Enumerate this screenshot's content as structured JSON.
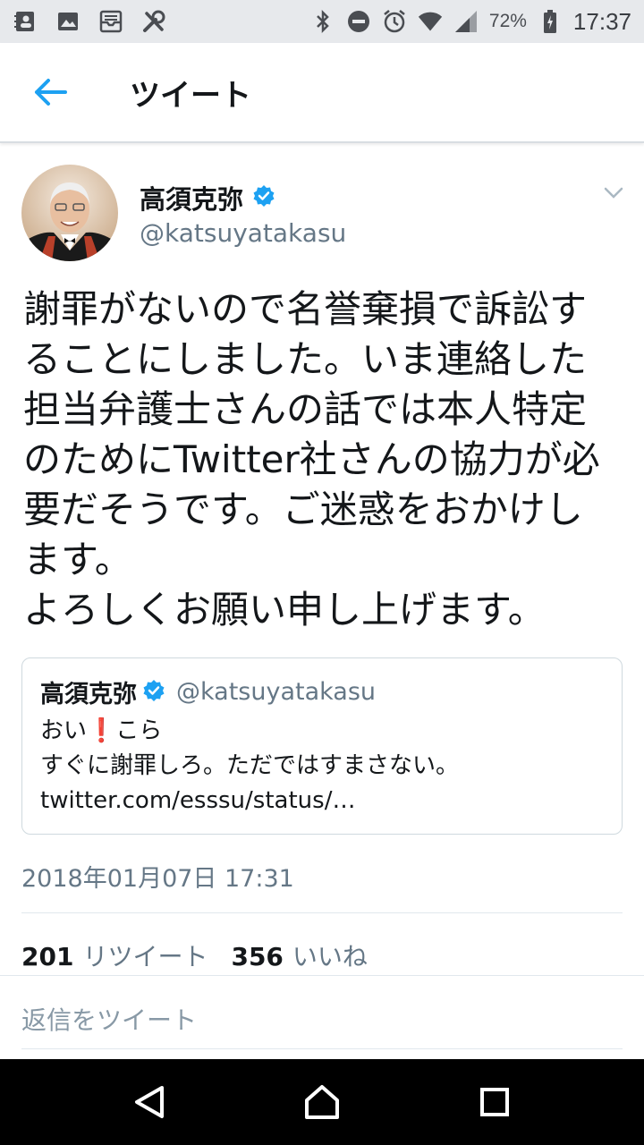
{
  "status_bar": {
    "left_icons": [
      "contacts-icon",
      "image-icon",
      "inbox-icon",
      "tools-icon"
    ],
    "right_icons": [
      "bluetooth-icon",
      "do-not-disturb-icon",
      "alarm-icon",
      "wifi-icon",
      "signal-icon",
      "battery-icon"
    ],
    "battery": "72%",
    "time": "17:37"
  },
  "header": {
    "title": "ツイート"
  },
  "tweet": {
    "author": {
      "name": "高須克弥",
      "handle": "@katsuyatakasu",
      "verified": true
    },
    "text_lines": [
      "謝罪がないので名誉棄損で訴訟す",
      "ることにしました。いま連絡した",
      "担当弁護士さんの話では本人特定",
      "のためにTwitter社さんの協力が必",
      "要だそうです。ご迷惑をおかけし",
      "ます。",
      "よろしくお願い申し上げます。"
    ],
    "quoted": {
      "name": "高須克弥",
      "handle": "@katsuyatakasu",
      "line1_before": "おい",
      "line1_emoji": "❗",
      "line1_after": "こら",
      "line2": "すぐに謝罪しろ。ただではすまさない。",
      "line3": "twitter.com/esssu/status/…"
    },
    "timestamp": "2018年01月07日 17:31",
    "stats": {
      "retweets": "201",
      "retweets_label": "リツイート",
      "likes": "356",
      "likes_label": "いいね"
    },
    "reply_placeholder": "返信をツイート"
  },
  "colors": {
    "accent": "#1da1f2",
    "text_primary": "#14171a",
    "text_secondary": "#657786"
  },
  "nav_bar": {
    "buttons": [
      "back-triangle-icon",
      "home-icon",
      "recents-icon"
    ]
  }
}
